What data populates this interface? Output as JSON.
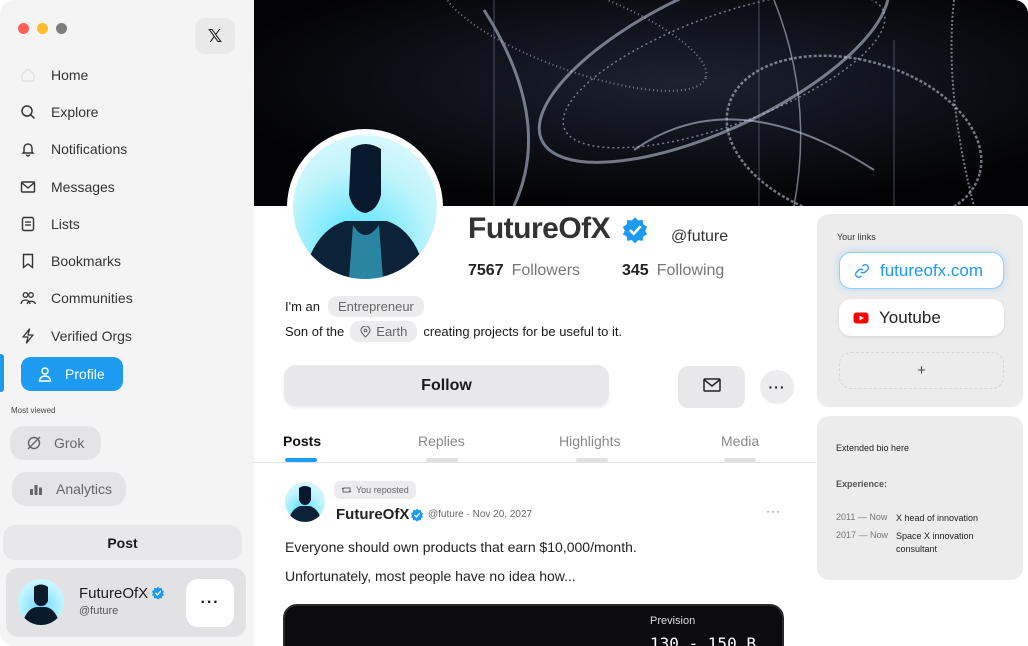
{
  "sidebar": {
    "traffic_colors": [
      "#ff5f57",
      "#febc2e",
      "#7d7d80"
    ],
    "logo": "𝕏",
    "nav": [
      {
        "label": "Home",
        "icon": "home-icon"
      },
      {
        "label": "Explore",
        "icon": "search-icon"
      },
      {
        "label": "Notifications",
        "icon": "bell-icon"
      },
      {
        "label": "Messages",
        "icon": "mail-icon"
      },
      {
        "label": "Lists",
        "icon": "list-icon"
      },
      {
        "label": "Bookmarks",
        "icon": "bookmark-icon"
      },
      {
        "label": "Communities",
        "icon": "people-icon"
      },
      {
        "label": "Verified Orgs",
        "icon": "lightning-icon"
      },
      {
        "label": "Profile",
        "icon": "user-icon",
        "active": true
      }
    ],
    "most_viewed_label": "Most viewed",
    "shortcuts": [
      {
        "label": "Grok",
        "icon": "grok-icon"
      },
      {
        "label": "Analytics",
        "icon": "bar-chart-icon"
      }
    ],
    "post_label": "Post",
    "account": {
      "name": "FutureOfX",
      "handle": "@future",
      "more": "···"
    }
  },
  "profile": {
    "name": "FutureOfX",
    "handle": "@future",
    "followers_count": "7567",
    "followers_label": "Followers",
    "following_count": "345",
    "following_label": "Following",
    "bio_prefix": "I'm an",
    "bio_tag": "Entrepreneur",
    "bio_line2_prefix": "Son of the",
    "bio_location": "Earth",
    "bio_line2_suffix": "creating projects for be useful to it.",
    "follow_label": "Follow",
    "more": "···"
  },
  "tabs": [
    {
      "label": "Posts",
      "active": true
    },
    {
      "label": "Replies"
    },
    {
      "label": "Highlights"
    },
    {
      "label": "Media"
    }
  ],
  "post": {
    "repost_label": "You reposted",
    "author": "FutureOfX",
    "meta": "@future · Nov 20, 2027",
    "more": "···",
    "line1": "Everyone should own products that earn $10,000/month.",
    "line2": "Unfortunately, most people have no idea how...",
    "media_label": "Prevision",
    "media_value": "130 - 150 B"
  },
  "links": {
    "title": "Your links",
    "items": [
      {
        "label": "futureofx.com",
        "icon": "link-icon"
      },
      {
        "label": "Youtube",
        "icon": "youtube-icon"
      }
    ],
    "add": "+"
  },
  "bio_panel": {
    "extended": "Extended bio here",
    "experience_label": "Experience:",
    "rows": [
      {
        "years": "2011 — Now",
        "desc": "X head of innovation"
      },
      {
        "years": "2017 — Now",
        "desc": "Space X innovation consultant"
      }
    ]
  },
  "colors": {
    "accent": "#1d9bf0",
    "youtube": "#ff0000"
  }
}
